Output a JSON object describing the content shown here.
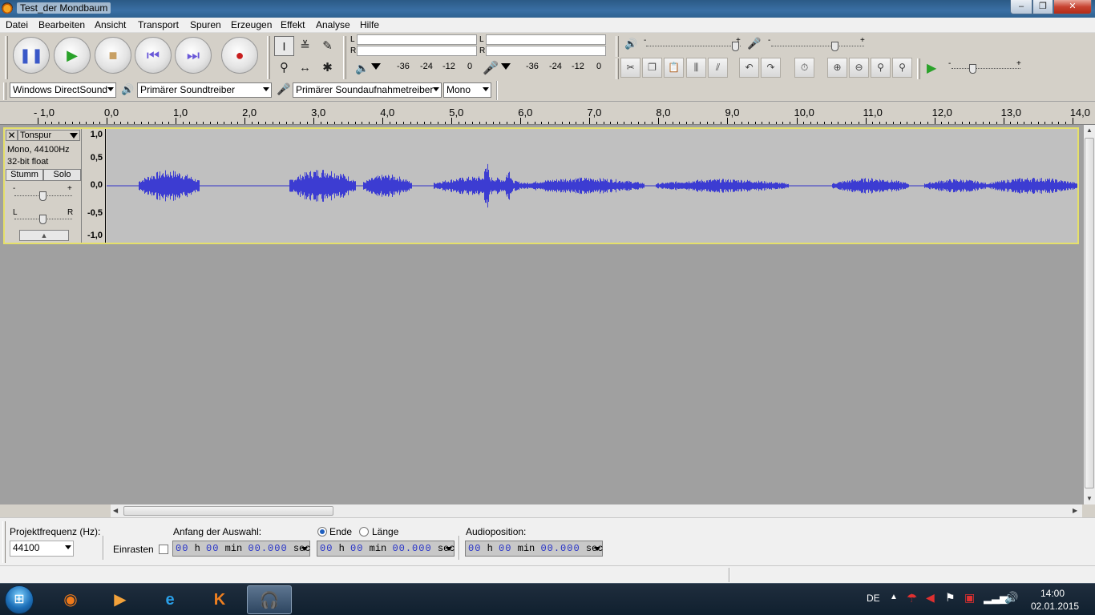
{
  "window": {
    "title": "Test_der Mondbaum",
    "minimize": "‒",
    "maximize": "❐",
    "close": "✕"
  },
  "menu": [
    "Datei",
    "Bearbeiten",
    "Ansicht",
    "Transport",
    "Spuren",
    "Erzeugen",
    "Effekt",
    "Analyse",
    "Hilfe"
  ],
  "meters": {
    "left_label": "L",
    "right_label": "R",
    "scale": [
      "-36",
      "-24",
      "-12",
      "0"
    ]
  },
  "sliders": {
    "minus": "-",
    "plus": "+"
  },
  "devices": {
    "host": "Windows DirectSound",
    "output": "Primärer Soundtreiber",
    "input": "Primärer Soundaufnahmetreiber",
    "channels": "Mono"
  },
  "ruler": [
    "- 1,0",
    "0,0",
    "1,0",
    "2,0",
    "3,0",
    "4,0",
    "5,0",
    "6,0",
    "7,0",
    "8,0",
    "9,0",
    "10,0",
    "11,0",
    "12,0",
    "13,0",
    "14,0"
  ],
  "track": {
    "close": "✕",
    "name": "Tonspur",
    "format": "Mono, 44100Hz",
    "bitdepth": "32-bit float",
    "mute": "Stumm",
    "solo": "Solo",
    "gain_minus": "-",
    "gain_plus": "+",
    "pan_left": "L",
    "pan_right": "R",
    "collapse": "▲",
    "vruler": [
      "1,0",
      "0,5",
      "0,0",
      "-0,5",
      "-1,0"
    ]
  },
  "selection": {
    "rate_label": "Projektfrequenz (Hz):",
    "rate_value": "44100",
    "snap_label": "Einrasten",
    "start_label": "Anfang der Auswahl:",
    "end_label": "Ende",
    "length_label": "Länge",
    "audiopos_label": "Audioposition:",
    "time_zero_h": "00",
    "unit_h": "h",
    "time_zero_min": "00",
    "unit_min": "min",
    "time_zero_sec": "00.000",
    "unit_sec": "sec"
  },
  "tray": {
    "lang": "DE",
    "time": "14:00",
    "date": "02.01.2015"
  }
}
